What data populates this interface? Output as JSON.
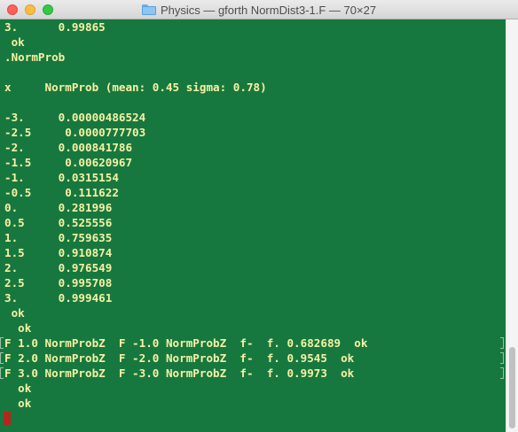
{
  "window": {
    "title": "Physics — gforth NormDist3-1.F — 70×27"
  },
  "terminal": {
    "lines": [
      "3.      0.99865",
      " ok",
      ".NormProb",
      "",
      "x     NormProb (mean: 0.45 sigma: 0.78)",
      "",
      "-3.     0.00000486524",
      "-2.5     0.0000777703",
      "-2.     0.000841786",
      "-1.5     0.00620967",
      "-1.     0.0315154",
      "-0.5     0.111622",
      "0.      0.281996",
      "0.5     0.525556",
      "1.      0.759635",
      "1.5     0.910874",
      "2.      0.976549",
      "2.5     0.995708",
      "3.      0.999461",
      " ok",
      "  ok",
      "F 1.0 NormProbZ  F -1.0 NormProbZ  f-  f. 0.682689  ok",
      "F 2.0 NormProbZ  F -2.0 NormProbZ  f-  f. 0.9545  ok",
      "F 3.0 NormProbZ  F -3.0 NormProbZ  f-  f. 0.9973  ok",
      "  ok",
      "  ok"
    ]
  },
  "colors": {
    "background": "#17783f",
    "text": "#f6f1a4",
    "cursor": "#b3261e"
  }
}
